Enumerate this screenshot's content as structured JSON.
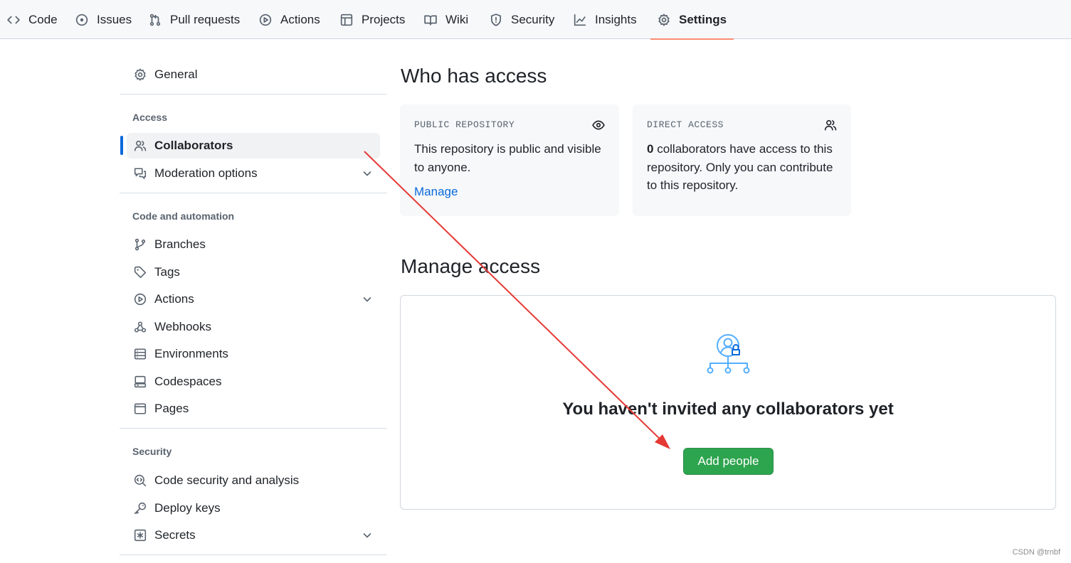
{
  "repo_nav": {
    "tabs": [
      {
        "label": "Code",
        "icon": "code-icon"
      },
      {
        "label": "Issues",
        "icon": "issue-opened-icon"
      },
      {
        "label": "Pull requests",
        "icon": "git-pull-request-icon"
      },
      {
        "label": "Actions",
        "icon": "play-icon"
      },
      {
        "label": "Projects",
        "icon": "table-icon"
      },
      {
        "label": "Wiki",
        "icon": "book-icon"
      },
      {
        "label": "Security",
        "icon": "shield-icon"
      },
      {
        "label": "Insights",
        "icon": "graph-icon"
      },
      {
        "label": "Settings",
        "icon": "gear-icon",
        "selected": true
      }
    ]
  },
  "sidebar": {
    "general": "General",
    "sections": [
      {
        "heading": "Access",
        "items": [
          {
            "label": "Collaborators",
            "icon": "people-icon",
            "selected": true
          },
          {
            "label": "Moderation options",
            "icon": "comment-discussion-icon",
            "expandable": true
          }
        ]
      },
      {
        "heading": "Code and automation",
        "items": [
          {
            "label": "Branches",
            "icon": "git-branch-icon"
          },
          {
            "label": "Tags",
            "icon": "tag-icon"
          },
          {
            "label": "Actions",
            "icon": "play-icon",
            "expandable": true
          },
          {
            "label": "Webhooks",
            "icon": "webhook-icon"
          },
          {
            "label": "Environments",
            "icon": "server-icon"
          },
          {
            "label": "Codespaces",
            "icon": "codespaces-icon"
          },
          {
            "label": "Pages",
            "icon": "browser-icon"
          }
        ]
      },
      {
        "heading": "Security",
        "items": [
          {
            "label": "Code security and analysis",
            "icon": "codescan-icon"
          },
          {
            "label": "Deploy keys",
            "icon": "key-icon"
          },
          {
            "label": "Secrets",
            "icon": "key-asterisk-icon",
            "expandable": true
          }
        ]
      }
    ]
  },
  "main": {
    "who_has_access": "Who has access",
    "public_card": {
      "caption": "PUBLIC REPOSITORY",
      "text": "This repository is public and visible to anyone.",
      "link": "Manage"
    },
    "direct_card": {
      "count": "0",
      "caption": "DIRECT ACCESS",
      "text": " collaborators have access to this repository. Only you can contribute to this repository."
    },
    "manage_access": "Manage access",
    "blank_state": {
      "title": "You haven't invited any collaborators yet",
      "button": "Add people"
    }
  },
  "colors": {
    "accent_blue": "#0969da",
    "selected_tab_underline": "#fd8c73",
    "button_green": "#2da44e",
    "annotation_arrow": "#e53935"
  },
  "watermark": "CSDN @trnbf"
}
